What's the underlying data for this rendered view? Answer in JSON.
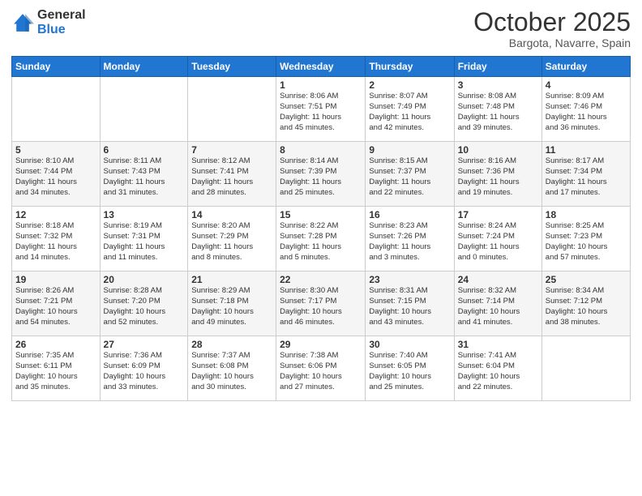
{
  "logo": {
    "general": "General",
    "blue": "Blue"
  },
  "header": {
    "month": "October 2025",
    "location": "Bargota, Navarre, Spain"
  },
  "weekdays": [
    "Sunday",
    "Monday",
    "Tuesday",
    "Wednesday",
    "Thursday",
    "Friday",
    "Saturday"
  ],
  "weeks": [
    [
      {
        "day": "",
        "info": ""
      },
      {
        "day": "",
        "info": ""
      },
      {
        "day": "",
        "info": ""
      },
      {
        "day": "1",
        "info": "Sunrise: 8:06 AM\nSunset: 7:51 PM\nDaylight: 11 hours\nand 45 minutes."
      },
      {
        "day": "2",
        "info": "Sunrise: 8:07 AM\nSunset: 7:49 PM\nDaylight: 11 hours\nand 42 minutes."
      },
      {
        "day": "3",
        "info": "Sunrise: 8:08 AM\nSunset: 7:48 PM\nDaylight: 11 hours\nand 39 minutes."
      },
      {
        "day": "4",
        "info": "Sunrise: 8:09 AM\nSunset: 7:46 PM\nDaylight: 11 hours\nand 36 minutes."
      }
    ],
    [
      {
        "day": "5",
        "info": "Sunrise: 8:10 AM\nSunset: 7:44 PM\nDaylight: 11 hours\nand 34 minutes."
      },
      {
        "day": "6",
        "info": "Sunrise: 8:11 AM\nSunset: 7:43 PM\nDaylight: 11 hours\nand 31 minutes."
      },
      {
        "day": "7",
        "info": "Sunrise: 8:12 AM\nSunset: 7:41 PM\nDaylight: 11 hours\nand 28 minutes."
      },
      {
        "day": "8",
        "info": "Sunrise: 8:14 AM\nSunset: 7:39 PM\nDaylight: 11 hours\nand 25 minutes."
      },
      {
        "day": "9",
        "info": "Sunrise: 8:15 AM\nSunset: 7:37 PM\nDaylight: 11 hours\nand 22 minutes."
      },
      {
        "day": "10",
        "info": "Sunrise: 8:16 AM\nSunset: 7:36 PM\nDaylight: 11 hours\nand 19 minutes."
      },
      {
        "day": "11",
        "info": "Sunrise: 8:17 AM\nSunset: 7:34 PM\nDaylight: 11 hours\nand 17 minutes."
      }
    ],
    [
      {
        "day": "12",
        "info": "Sunrise: 8:18 AM\nSunset: 7:32 PM\nDaylight: 11 hours\nand 14 minutes."
      },
      {
        "day": "13",
        "info": "Sunrise: 8:19 AM\nSunset: 7:31 PM\nDaylight: 11 hours\nand 11 minutes."
      },
      {
        "day": "14",
        "info": "Sunrise: 8:20 AM\nSunset: 7:29 PM\nDaylight: 11 hours\nand 8 minutes."
      },
      {
        "day": "15",
        "info": "Sunrise: 8:22 AM\nSunset: 7:28 PM\nDaylight: 11 hours\nand 5 minutes."
      },
      {
        "day": "16",
        "info": "Sunrise: 8:23 AM\nSunset: 7:26 PM\nDaylight: 11 hours\nand 3 minutes."
      },
      {
        "day": "17",
        "info": "Sunrise: 8:24 AM\nSunset: 7:24 PM\nDaylight: 11 hours\nand 0 minutes."
      },
      {
        "day": "18",
        "info": "Sunrise: 8:25 AM\nSunset: 7:23 PM\nDaylight: 10 hours\nand 57 minutes."
      }
    ],
    [
      {
        "day": "19",
        "info": "Sunrise: 8:26 AM\nSunset: 7:21 PM\nDaylight: 10 hours\nand 54 minutes."
      },
      {
        "day": "20",
        "info": "Sunrise: 8:28 AM\nSunset: 7:20 PM\nDaylight: 10 hours\nand 52 minutes."
      },
      {
        "day": "21",
        "info": "Sunrise: 8:29 AM\nSunset: 7:18 PM\nDaylight: 10 hours\nand 49 minutes."
      },
      {
        "day": "22",
        "info": "Sunrise: 8:30 AM\nSunset: 7:17 PM\nDaylight: 10 hours\nand 46 minutes."
      },
      {
        "day": "23",
        "info": "Sunrise: 8:31 AM\nSunset: 7:15 PM\nDaylight: 10 hours\nand 43 minutes."
      },
      {
        "day": "24",
        "info": "Sunrise: 8:32 AM\nSunset: 7:14 PM\nDaylight: 10 hours\nand 41 minutes."
      },
      {
        "day": "25",
        "info": "Sunrise: 8:34 AM\nSunset: 7:12 PM\nDaylight: 10 hours\nand 38 minutes."
      }
    ],
    [
      {
        "day": "26",
        "info": "Sunrise: 7:35 AM\nSunset: 6:11 PM\nDaylight: 10 hours\nand 35 minutes."
      },
      {
        "day": "27",
        "info": "Sunrise: 7:36 AM\nSunset: 6:09 PM\nDaylight: 10 hours\nand 33 minutes."
      },
      {
        "day": "28",
        "info": "Sunrise: 7:37 AM\nSunset: 6:08 PM\nDaylight: 10 hours\nand 30 minutes."
      },
      {
        "day": "29",
        "info": "Sunrise: 7:38 AM\nSunset: 6:06 PM\nDaylight: 10 hours\nand 27 minutes."
      },
      {
        "day": "30",
        "info": "Sunrise: 7:40 AM\nSunset: 6:05 PM\nDaylight: 10 hours\nand 25 minutes."
      },
      {
        "day": "31",
        "info": "Sunrise: 7:41 AM\nSunset: 6:04 PM\nDaylight: 10 hours\nand 22 minutes."
      },
      {
        "day": "",
        "info": ""
      }
    ]
  ]
}
